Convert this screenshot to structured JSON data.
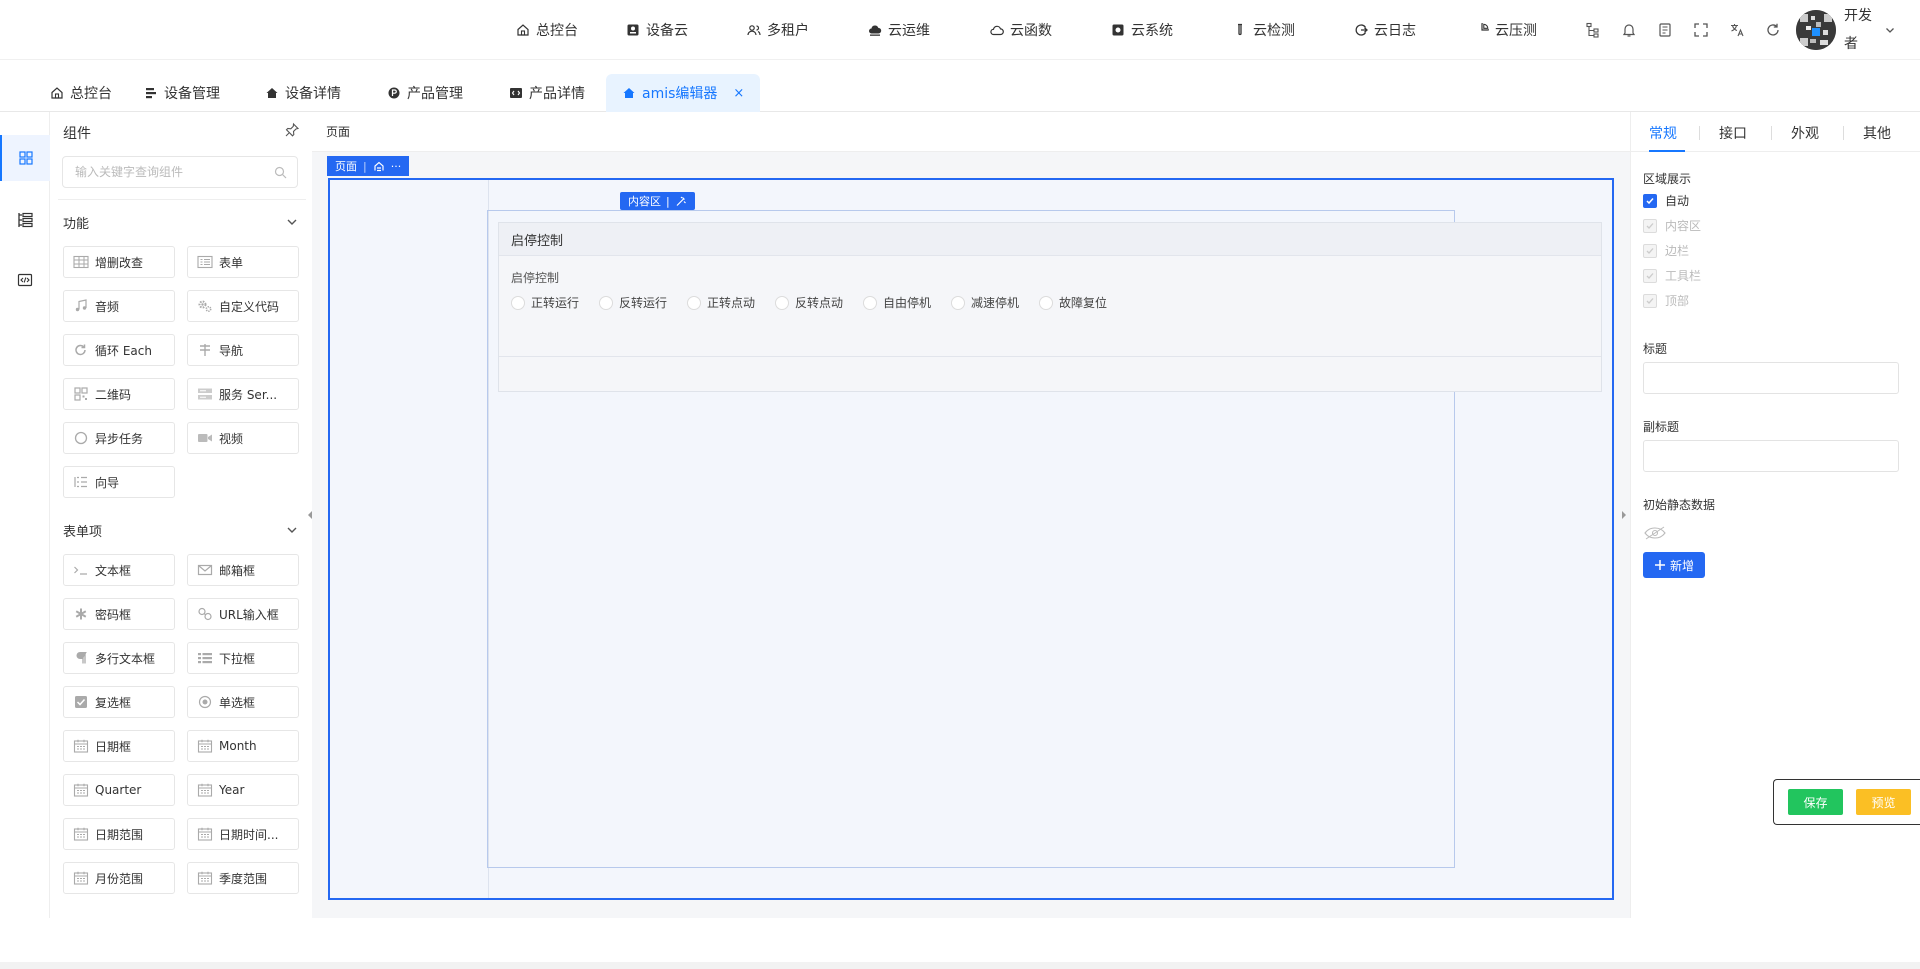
{
  "topnav": {
    "items": [
      {
        "label": "总控台",
        "icon": "home-icon"
      },
      {
        "label": "设备云",
        "icon": "device-icon"
      },
      {
        "label": "多租户",
        "icon": "users-icon"
      },
      {
        "label": "云运维",
        "icon": "cloud-ops-icon"
      },
      {
        "label": "云函数",
        "icon": "cloud-function-icon"
      },
      {
        "label": "云系统",
        "icon": "cloud-system-icon"
      },
      {
        "label": "云检测",
        "icon": "test-tube-icon"
      },
      {
        "label": "云日志",
        "icon": "log-icon"
      },
      {
        "label": "云压测",
        "icon": "pie-chart-icon"
      }
    ],
    "user_name": "开发者"
  },
  "tabs": [
    {
      "label": "总控台",
      "icon": "home-icon"
    },
    {
      "label": "设备管理",
      "icon": "list-icon"
    },
    {
      "label": "设备详情",
      "icon": "house-icon"
    },
    {
      "label": "产品管理",
      "icon": "product-icon"
    },
    {
      "label": "产品详情",
      "icon": "code-icon"
    },
    {
      "label": "amis编辑器",
      "icon": "house-icon",
      "active": true,
      "close": "×"
    }
  ],
  "panel": {
    "title": "组件",
    "search_placeholder": "输入关键字查询组件",
    "sections": [
      {
        "title": "功能",
        "items": [
          {
            "label": "增删改查",
            "icon": "table-icon"
          },
          {
            "label": "表单",
            "icon": "form-icon"
          },
          {
            "label": "音频",
            "icon": "music-icon"
          },
          {
            "label": "自定义代码",
            "icon": "gear-icon"
          },
          {
            "label": "循环 Each",
            "icon": "refresh-icon"
          },
          {
            "label": "导航",
            "icon": "signpost-icon"
          },
          {
            "label": "二维码",
            "icon": "qrcode-icon"
          },
          {
            "label": "服务 Ser...",
            "icon": "server-icon"
          },
          {
            "label": "异步任务",
            "icon": "circle-icon"
          },
          {
            "label": "视频",
            "icon": "video-icon"
          },
          {
            "label": "向导",
            "icon": "steps-icon"
          }
        ]
      },
      {
        "title": "表单项",
        "items": [
          {
            "label": "文本框",
            "icon": "terminal-icon"
          },
          {
            "label": "邮箱框",
            "icon": "mail-icon"
          },
          {
            "label": "密码框",
            "icon": "asterisk-icon"
          },
          {
            "label": "URL输入框",
            "icon": "link-icon"
          },
          {
            "label": "多行文本框",
            "icon": "paragraph-icon"
          },
          {
            "label": "下拉框",
            "icon": "select-list-icon"
          },
          {
            "label": "复选框",
            "icon": "checkbox-icon"
          },
          {
            "label": "单选框",
            "icon": "radio-icon"
          },
          {
            "label": "日期框",
            "icon": "calendar-icon"
          },
          {
            "label": "Month",
            "icon": "calendar-icon"
          },
          {
            "label": "Quarter",
            "icon": "calendar-icon"
          },
          {
            "label": "Year",
            "icon": "calendar-icon"
          },
          {
            "label": "日期范围",
            "icon": "calendar-icon"
          },
          {
            "label": "日期时间...",
            "icon": "calendar-icon"
          },
          {
            "label": "月份范围",
            "icon": "calendar-icon"
          },
          {
            "label": "季度范围",
            "icon": "calendar-icon"
          }
        ]
      }
    ]
  },
  "canvas": {
    "breadcrumb": "页面",
    "page_label": "页面",
    "page_label_sep": "|",
    "page_label_more": "···",
    "content_label": "内容区",
    "content_label_sep": "|",
    "card": {
      "title": "启停控制",
      "field_label": "启停控制",
      "options": [
        "正转运行",
        "反转运行",
        "正转点动",
        "反转点动",
        "自由停机",
        "减速停机",
        "故障复位"
      ]
    }
  },
  "settings": {
    "tabs": [
      "常规",
      "接口",
      "外观",
      "其他"
    ],
    "active_tab": "常规",
    "region_label": "区域展示",
    "regions": [
      {
        "label": "自动",
        "checked": true
      },
      {
        "label": "内容区",
        "checked": false
      },
      {
        "label": "边栏",
        "checked": false
      },
      {
        "label": "工具栏",
        "checked": false
      },
      {
        "label": "顶部",
        "checked": false
      }
    ],
    "title_label": "标题",
    "title_value": "",
    "subtitle_label": "副标题",
    "subtitle_value": "",
    "init_data_label": "初始静态数据",
    "add_button": "新增"
  },
  "actions": {
    "save": "保存",
    "preview": "预览"
  },
  "colors": {
    "primary": "#2468f2",
    "save": "#22c55e",
    "preview": "#fbbf24"
  }
}
